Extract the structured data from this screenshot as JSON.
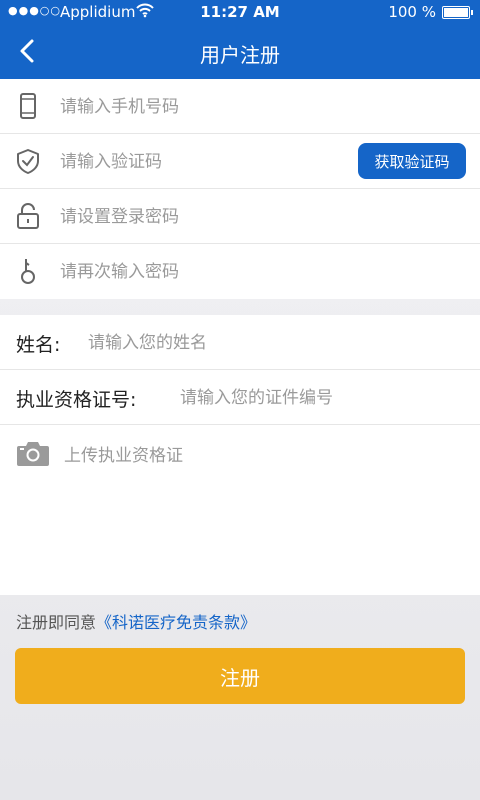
{
  "status_bar": {
    "carrier": "Applidium",
    "time": "11:27 AM",
    "battery": "100 %"
  },
  "nav": {
    "title": "用户注册"
  },
  "credentials": {
    "phone_placeholder": "请输入手机号码",
    "code_placeholder": "请输入验证码",
    "get_code_label": "获取验证码",
    "password_placeholder": "请设置登录密码",
    "confirm_placeholder": "请再次输入密码"
  },
  "profile": {
    "name_label": "姓名:",
    "name_placeholder": "请输入您的姓名",
    "license_label": "执业资格证号:",
    "license_placeholder": "请输入您的证件编号",
    "upload_label": "上传执业资格证"
  },
  "agreement": {
    "prefix": "注册即同意",
    "link": "《科诺医疗免责条款》"
  },
  "register_label": "注册",
  "colors": {
    "primary": "#1565c8",
    "accent": "#f0ad1c",
    "icon_gray": "#666666"
  }
}
